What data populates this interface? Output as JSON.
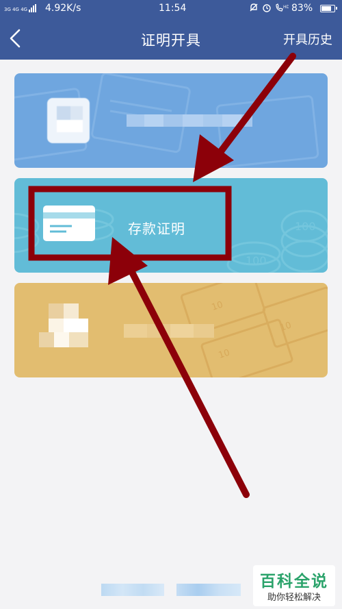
{
  "status_bar": {
    "network_tag": "3G 4G 4G",
    "speed": "4.92K/s",
    "time": "11:54",
    "icons": [
      "mute-bell-icon",
      "alarm-icon",
      "hd-call-icon"
    ],
    "battery_percent": "83%",
    "battery_level": 0.83
  },
  "nav": {
    "title": "证明开具",
    "history_label": "开具历史"
  },
  "cards": [
    {
      "id": "redacted-1",
      "label": "",
      "color": "#6fa6df"
    },
    {
      "id": "deposit",
      "label": "存款证明",
      "color": "#62bcd7"
    },
    {
      "id": "redacted-2",
      "label": "",
      "color": "#e2bd70"
    }
  ],
  "watermark": {
    "title": "百科全说",
    "subtitle": "助你轻松解决"
  },
  "annotation": {
    "highlight_color": "#8c0009"
  }
}
